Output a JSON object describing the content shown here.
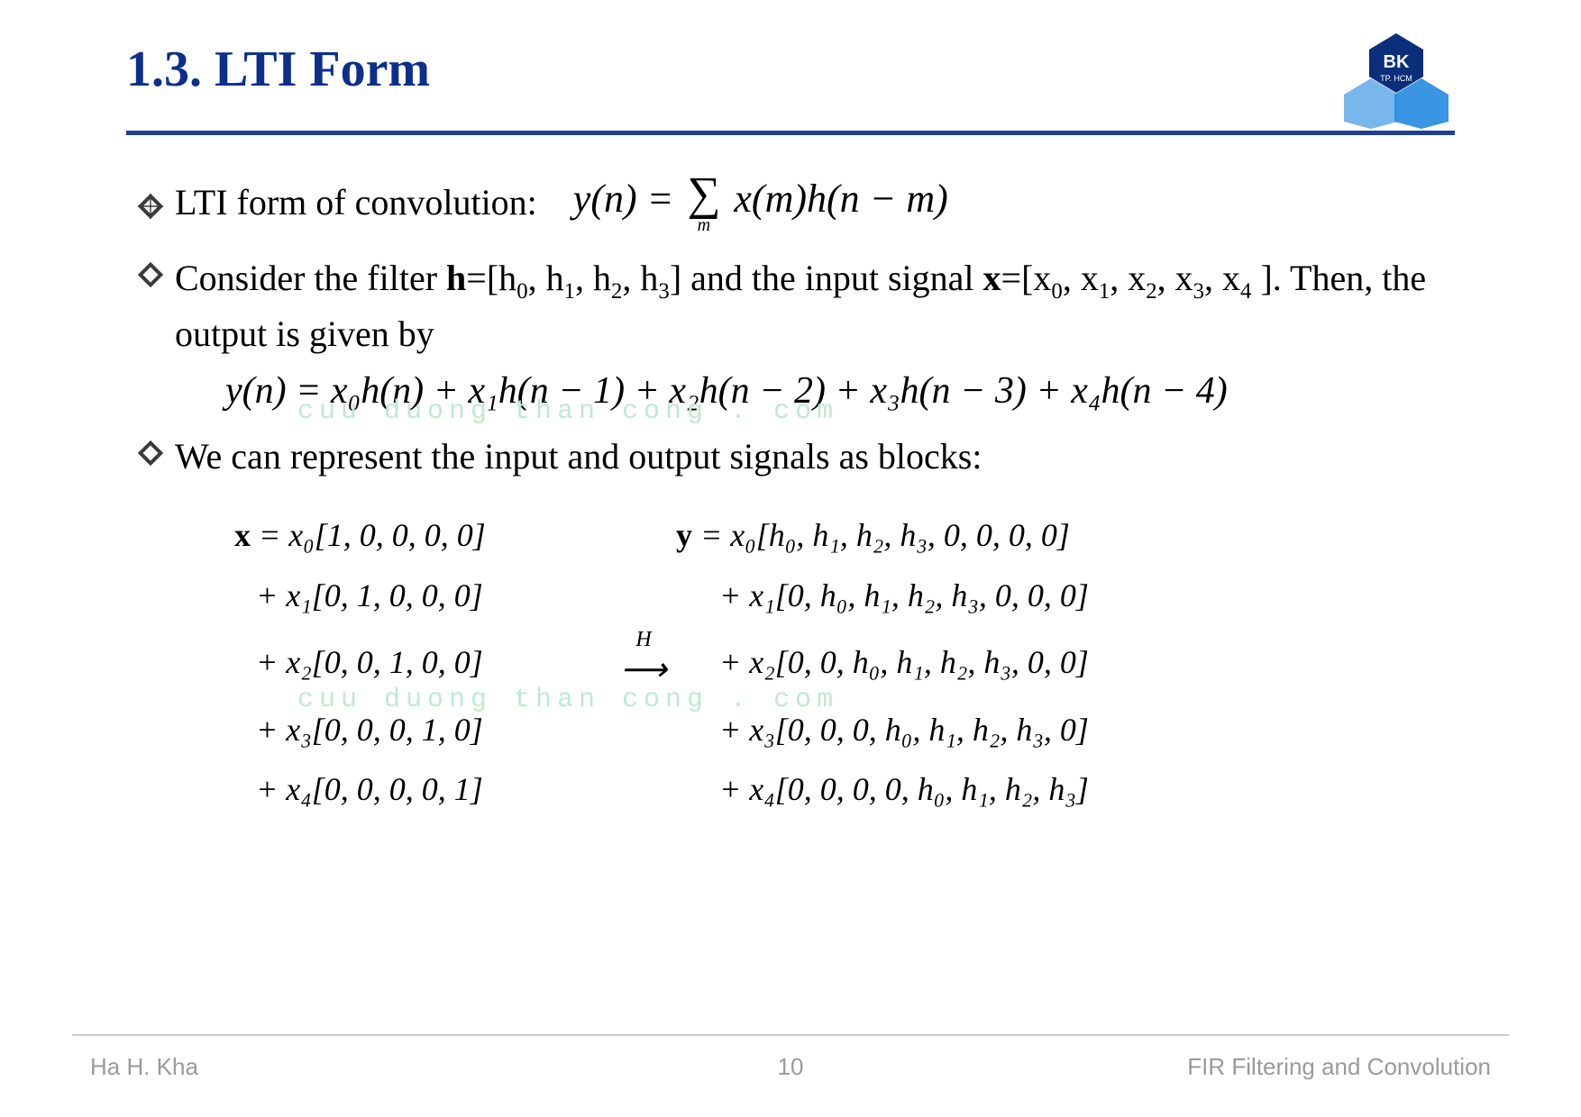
{
  "header": {
    "title": "1.3. LTI Form"
  },
  "logo": {
    "label_top": "BK",
    "label_bottom": "TP. HCM"
  },
  "bullets": {
    "b1": {
      "text": "LTI form of convolution:"
    },
    "b1_formula": {
      "lhs": "y(n) =",
      "sum_sub": "m",
      "rhs": "x(m)h(n − m)"
    },
    "b2": {
      "prefix": "Consider the filter ",
      "h_bold": "h",
      "h_def": "=[h",
      "h_end": "] and the input signal ",
      "x_bold": "x",
      "x_def": "=[x",
      "x_tail": "]. Then, the output is given by",
      "h_sub0": "0",
      "h_sub1": "1",
      "h_sub2": "2",
      "h_sub3": "3",
      "x_sub0": "0",
      "x_sub1": "1",
      "x_sub2": "2",
      "x_sub3": "3",
      "x_sub4": "4"
    },
    "eq_yn": "y(n) = x₀h(n) + x₁h(n − 1) + x₂h(n − 2) + x₃h(n − 3) + x₄h(n − 4)",
    "b3": {
      "text": "We can represent the input and output signals as blocks:"
    }
  },
  "watermarks": {
    "w1": "cuu duong than cong . com",
    "w2": "cuu duong than cong . com"
  },
  "blocks": {
    "x_label": "x",
    "y_label": "y",
    "H_label": "H",
    "arrow": "⟶",
    "x_rows": [
      "= x₀[1, 0, 0, 0, 0]",
      "+ x₁[0, 1, 0, 0, 0]",
      "+ x₂[0, 0, 1, 0, 0]",
      "+ x₃[0, 0, 0, 1, 0]",
      "+ x₄[0, 0, 0, 0, 1]"
    ],
    "y_rows": [
      "= x₀[h₀, h₁, h₂, h₃, 0, 0, 0, 0]",
      "+ x₁[0, h₀, h₁, h₂, h₃, 0, 0, 0]",
      "+ x₂[0, 0, h₀, h₁, h₂, h₃, 0, 0]",
      "+ x₃[0, 0, 0, h₀, h₁, h₂, h₃, 0]",
      "+ x₄[0, 0, 0, 0, h₀, h₁, h₂, h₃]"
    ]
  },
  "footer": {
    "left": "Ha H. Kha",
    "center": "10",
    "right": "FIR Filtering and Convolution"
  }
}
